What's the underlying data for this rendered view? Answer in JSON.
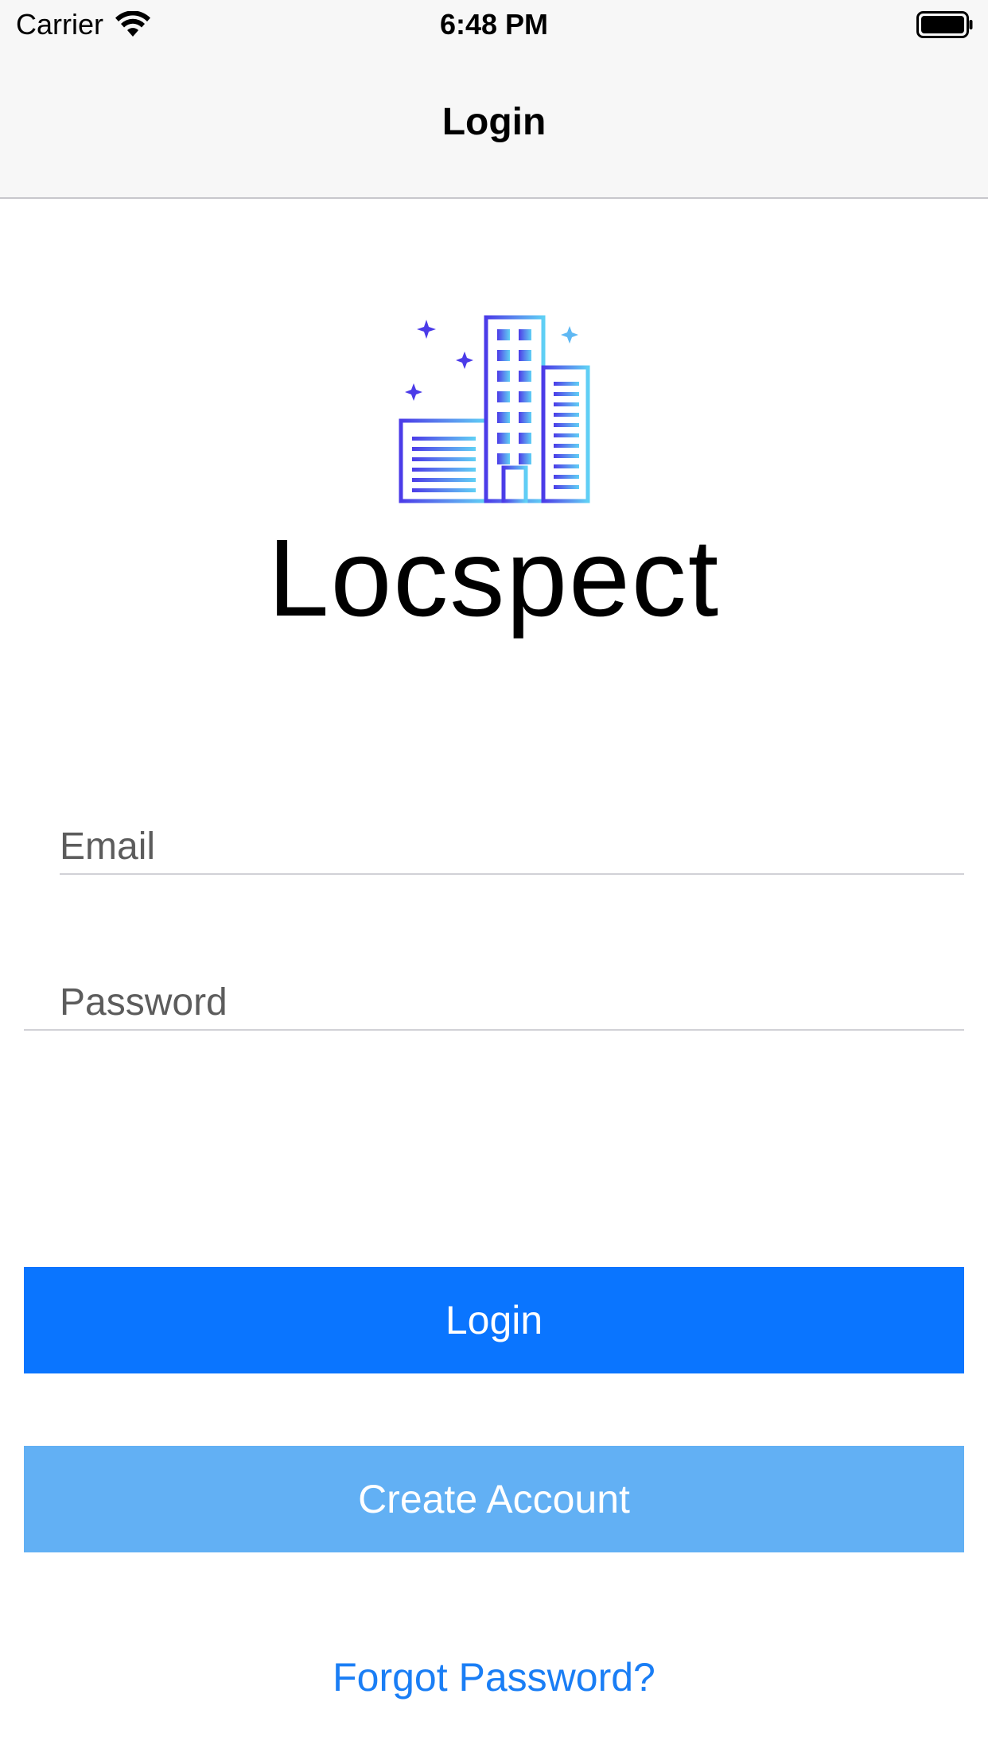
{
  "status_bar": {
    "carrier": "Carrier",
    "time": "6:48 PM",
    "wifi_icon": "wifi-icon",
    "battery_icon": "battery-full-icon"
  },
  "nav": {
    "title": "Login"
  },
  "logo": {
    "icon": "city-buildings-icon",
    "text": "Locspect",
    "gradient_start": "#4b3be8",
    "gradient_end": "#5fd0f5"
  },
  "form": {
    "email_placeholder": "Email",
    "email_value": "",
    "password_placeholder": "Password",
    "password_value": ""
  },
  "buttons": {
    "login_label": "Login",
    "login_color": "#0a75ff",
    "create_account_label": "Create Account",
    "create_account_color": "#62b0f4",
    "forgot_password_label": "Forgot Password?",
    "forgot_password_color": "#1a7ef5"
  }
}
